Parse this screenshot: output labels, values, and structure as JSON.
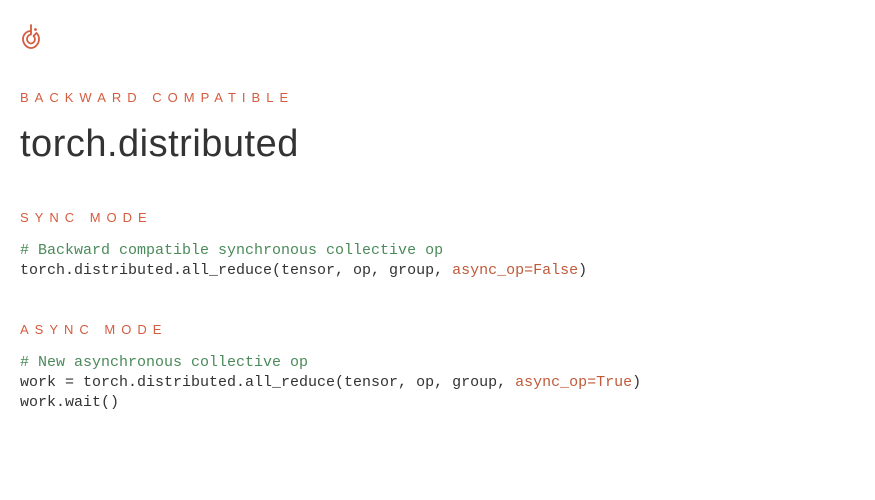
{
  "eyebrow": "BACKWARD COMPATIBLE",
  "title": "torch.distributed",
  "sync": {
    "label": "SYNC MODE",
    "comment": "# Backward compatible synchronous collective op",
    "line_prefix": "torch.distributed.all_reduce(tensor, op, group, ",
    "kw": "async_op=False",
    "line_suffix": ")"
  },
  "async": {
    "label": "ASYNC MODE",
    "comment": "# New asynchronous collective op",
    "line1_prefix": "work = torch.distributed.all_reduce(tensor, op, group, ",
    "line1_kw": "async_op=True",
    "line1_suffix": ")",
    "line2": "work.wait()"
  },
  "colors": {
    "accent": "#d45c3f",
    "comment": "#4a8a5a",
    "text": "#333333"
  }
}
